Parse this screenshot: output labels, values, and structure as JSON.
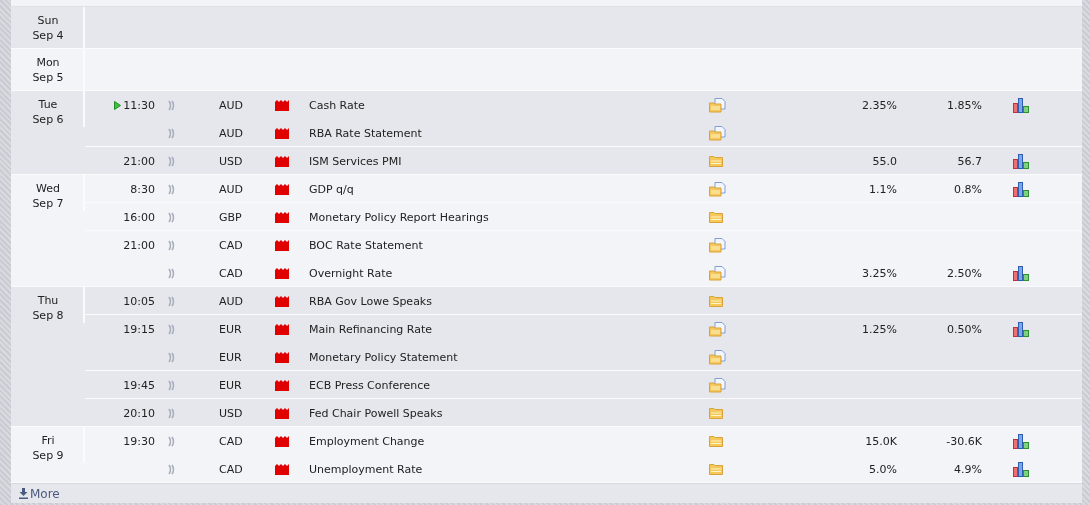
{
  "days": [
    {
      "day": "Sun",
      "date": "Sep 4"
    },
    {
      "day": "Mon",
      "date": "Sep 5"
    },
    {
      "day": "Tue",
      "date": "Sep 6",
      "slots": [
        {
          "time": "11:30",
          "upcoming": true,
          "events": [
            {
              "currency": "AUD",
              "event": "Cash Rate",
              "with_document": true,
              "actual": "2.35%",
              "forecast": "1.85%",
              "chart": true
            },
            {
              "currency": "AUD",
              "event": "RBA Rate Statement",
              "with_document": true,
              "chart": false
            }
          ]
        },
        {
          "time": "21:00",
          "events": [
            {
              "currency": "USD",
              "event": "ISM Services PMI",
              "with_document": false,
              "actual": "55.0",
              "forecast": "56.7",
              "chart": true
            }
          ]
        }
      ]
    },
    {
      "day": "Wed",
      "date": "Sep 7",
      "slots": [
        {
          "time": "8:30",
          "events": [
            {
              "currency": "AUD",
              "event": "GDP q/q",
              "with_document": true,
              "actual": "1.1%",
              "forecast": "0.8%",
              "chart": true
            }
          ]
        },
        {
          "time": "16:00",
          "events": [
            {
              "currency": "GBP",
              "event": "Monetary Policy Report Hearings",
              "with_document": false,
              "chart": false
            }
          ]
        },
        {
          "time": "21:00",
          "events": [
            {
              "currency": "CAD",
              "event": "BOC Rate Statement",
              "with_document": true,
              "chart": false
            },
            {
              "currency": "CAD",
              "event": "Overnight Rate",
              "with_document": true,
              "actual": "3.25%",
              "forecast": "2.50%",
              "chart": true
            }
          ]
        }
      ]
    },
    {
      "day": "Thu",
      "date": "Sep 8",
      "slots": [
        {
          "time": "10:05",
          "events": [
            {
              "currency": "AUD",
              "event": "RBA Gov Lowe Speaks",
              "with_document": false,
              "chart": false
            }
          ]
        },
        {
          "time": "19:15",
          "events": [
            {
              "currency": "EUR",
              "event": "Main Refinancing Rate",
              "with_document": true,
              "actual": "1.25%",
              "forecast": "0.50%",
              "chart": true
            },
            {
              "currency": "EUR",
              "event": "Monetary Policy Statement",
              "with_document": true,
              "chart": false
            }
          ]
        },
        {
          "time": "19:45",
          "events": [
            {
              "currency": "EUR",
              "event": "ECB Press Conference",
              "with_document": true,
              "chart": false
            }
          ]
        },
        {
          "time": "20:10",
          "events": [
            {
              "currency": "USD",
              "event": "Fed Chair Powell Speaks",
              "with_document": false,
              "chart": false
            }
          ]
        }
      ]
    },
    {
      "day": "Fri",
      "date": "Sep 9",
      "slots": [
        {
          "time": "19:30",
          "events": [
            {
              "currency": "CAD",
              "event": "Employment Change",
              "with_document": false,
              "actual": "15.0K",
              "forecast": "-30.6K",
              "chart": true
            },
            {
              "currency": "CAD",
              "event": "Unemployment Rate",
              "with_document": false,
              "actual": "5.0%",
              "forecast": "4.9%",
              "chart": true
            }
          ]
        }
      ]
    }
  ],
  "more_link": "More"
}
